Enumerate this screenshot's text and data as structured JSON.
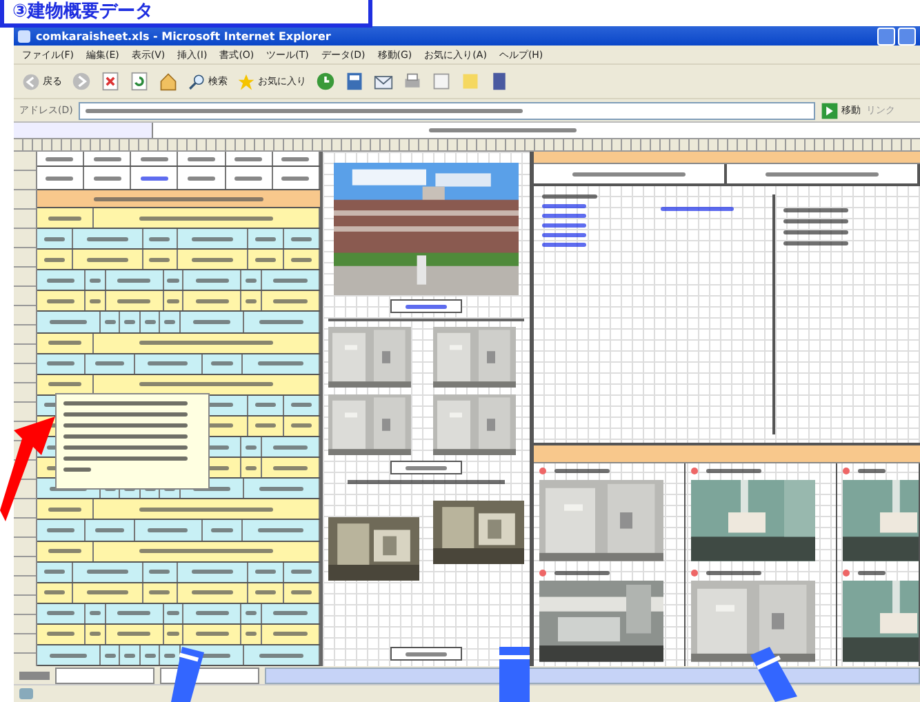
{
  "slide_label": "③建物概要データ",
  "window": {
    "title": "comkaraisheet.xls - Microsoft Internet Explorer"
  },
  "menu": [
    "ファイル(F)",
    "編集(E)",
    "表示(V)",
    "挿入(I)",
    "書式(O)",
    "ツール(T)",
    "データ(D)",
    "移動(G)",
    "お気に入り(A)",
    "ヘルプ(H)"
  ],
  "toolbar": {
    "back": "戻る",
    "search": "検索",
    "favorites": "お気に入り"
  },
  "address_bar": {
    "label": "アドレス(D)",
    "go": "移動",
    "links": "リンク"
  },
  "form_rows": [
    {
      "color": "#fff5a8"
    },
    {
      "color": "#c8f0f5"
    },
    {
      "color": "#fff5a8"
    },
    {
      "color": "#c8f0f5"
    },
    {
      "color": "#fff5a8"
    },
    {
      "color": "#c8f0f5"
    },
    {
      "color": "#fff5a8"
    },
    {
      "color": "#c8f0f5"
    },
    {
      "color": "#fff5a8"
    },
    {
      "color": "#c8f0f5"
    },
    {
      "color": "#fff5a8"
    },
    {
      "color": "#c8f0f5"
    },
    {
      "color": "#fff5a8"
    },
    {
      "color": "#c8f0f5"
    },
    {
      "color": "#fff5a8"
    },
    {
      "color": "#c8f0f5"
    },
    {
      "color": "#fff5a8"
    },
    {
      "color": "#c8f0f5"
    },
    {
      "color": "#fff5a8"
    },
    {
      "color": "#c8f0f5"
    },
    {
      "color": "#fff5a8"
    },
    {
      "color": "#c8f0f5"
    }
  ]
}
